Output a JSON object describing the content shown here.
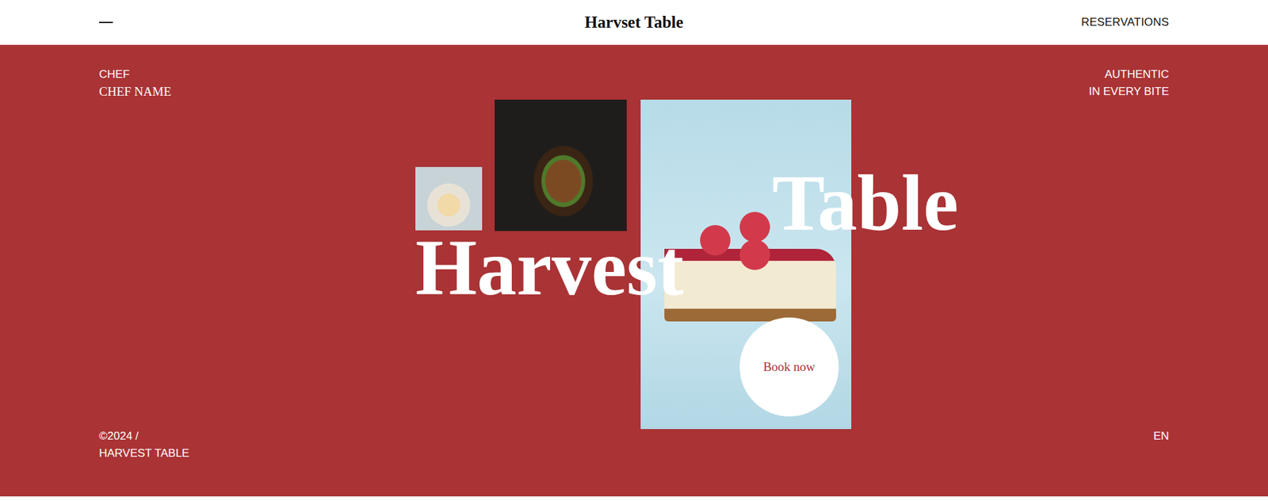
{
  "header": {
    "title": "Harvset Table",
    "reservations": "RESERVATIONS"
  },
  "hero": {
    "chef_label": "CHEF",
    "chef_name": "CHEF NAME",
    "tagline": [
      "AUTHENTIC",
      "IN EVERY BITE"
    ],
    "headline": [
      "Harvest",
      "Table"
    ],
    "cta": "Book now"
  },
  "footer": {
    "copyright": "©2024 /",
    "brand": "HARVEST TABLE",
    "language": "EN"
  }
}
